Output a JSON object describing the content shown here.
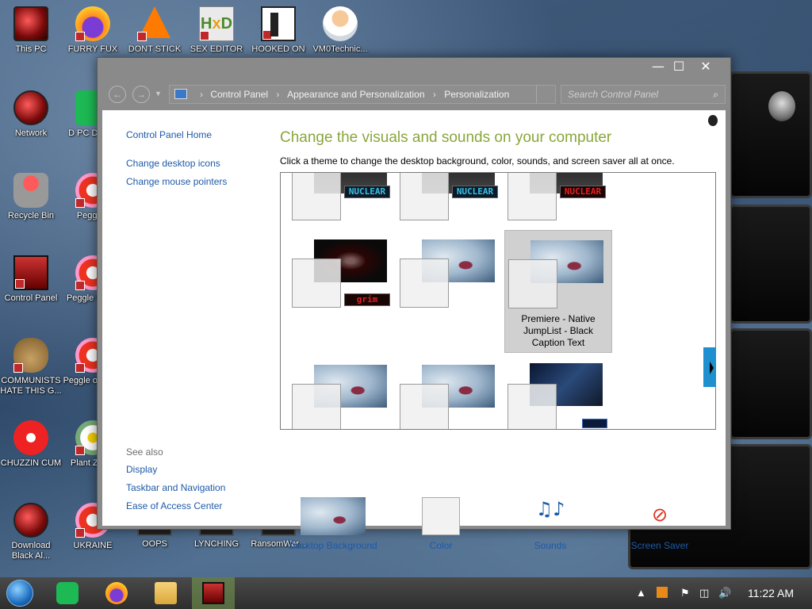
{
  "desktop_icons": [
    {
      "label": "This PC"
    },
    {
      "label": "FURRY FUX"
    },
    {
      "label": "DONT STICK"
    },
    {
      "label": "SEX EDITOR"
    },
    {
      "label": "HOOKED ON"
    },
    {
      "label": "VM0Technic..."
    },
    {
      "label": "Network"
    },
    {
      "label": "D PC DUMB"
    },
    {
      "label": "Recycle Bin"
    },
    {
      "label": "Peggle I"
    },
    {
      "label": "Control Panel"
    },
    {
      "label": "Peggle I Delu"
    },
    {
      "label": "COMMUNISTS HATE THIS G..."
    },
    {
      "label": "Peggle of Warc"
    },
    {
      "label": "CHUZZIN CUM"
    },
    {
      "label": "Plant Zomb"
    },
    {
      "label": "Download Black Al..."
    },
    {
      "label": "UKRAINE"
    },
    {
      "label": "OOPS"
    },
    {
      "label": "LYNCHING"
    },
    {
      "label": "RansomWar..."
    }
  ],
  "window": {
    "controls": {
      "minimize": "—",
      "maximize": "☐",
      "close": "✕"
    },
    "address": {
      "crumbs": [
        "Control Panel",
        "Appearance and Personalization",
        "Personalization"
      ],
      "separator": "›"
    },
    "search": {
      "placeholder": "Search Control Panel",
      "icon": "⌕"
    },
    "sidebar": {
      "home": "Control Panel Home",
      "links": [
        "Change desktop icons",
        "Change mouse pointers"
      ],
      "see_also_title": "See also",
      "see_also": [
        "Display",
        "Taskbar and Navigation",
        "Ease of Access Center"
      ]
    },
    "heading": "Change the visuals and sounds on your computer",
    "subtitle": "Click a theme to change the desktop background, color, sounds, and screen saver all at once.",
    "themes": [
      {
        "tag": "NUCLEAR",
        "tag_color": "#3ac0e8"
      },
      {
        "tag": "NUCLEAR",
        "tag_color": "#3ac0e8"
      },
      {
        "tag": "NUCLEAR",
        "tag_color": "#e82020"
      },
      {
        "tag": "grim",
        "tag_color": "#e82020"
      },
      {
        "name": ""
      },
      {
        "name": "Premiere - Native JumpList - Black Caption Text",
        "selected": true
      },
      {
        "name": ""
      },
      {
        "name": ""
      },
      {
        "name": ""
      }
    ],
    "bottom_options": [
      {
        "label": "Desktop Background"
      },
      {
        "label": "Color"
      },
      {
        "label": "Sounds"
      },
      {
        "label": "Screen Saver"
      }
    ]
  },
  "taskbar": {
    "clock": "11:22 AM",
    "accent": "#1e90d0"
  }
}
